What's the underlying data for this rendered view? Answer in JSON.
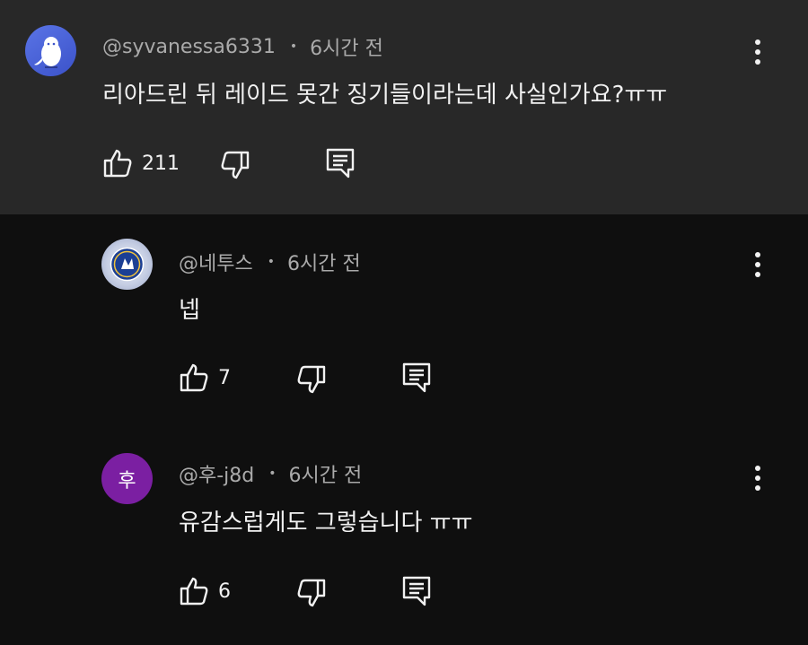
{
  "comments": [
    {
      "author": "@syvanessa6331",
      "time": "6시간 전",
      "text": "리아드린 뒤 레이드 못간 징기들이라는데 사실인가요?ㅠㅠ",
      "likes": "211",
      "avatar": "owl-avatar"
    },
    {
      "author": "@네투스",
      "time": "6시간 전",
      "text": "넵",
      "likes": "7",
      "avatar": "club-crest-avatar"
    },
    {
      "author": "@후-j8d",
      "time": "6시간 전",
      "text": "유감스럽게도 그렇습니다 ㅠㅠ",
      "likes": "6",
      "avatar_initial": "후",
      "avatar_color": "#7b1fa2"
    }
  ],
  "separator": "•",
  "icons": {
    "like": "thumbs-up-icon",
    "dislike": "thumbs-down-icon",
    "reply": "reply-comment-icon",
    "menu": "more-vertical-icon"
  }
}
